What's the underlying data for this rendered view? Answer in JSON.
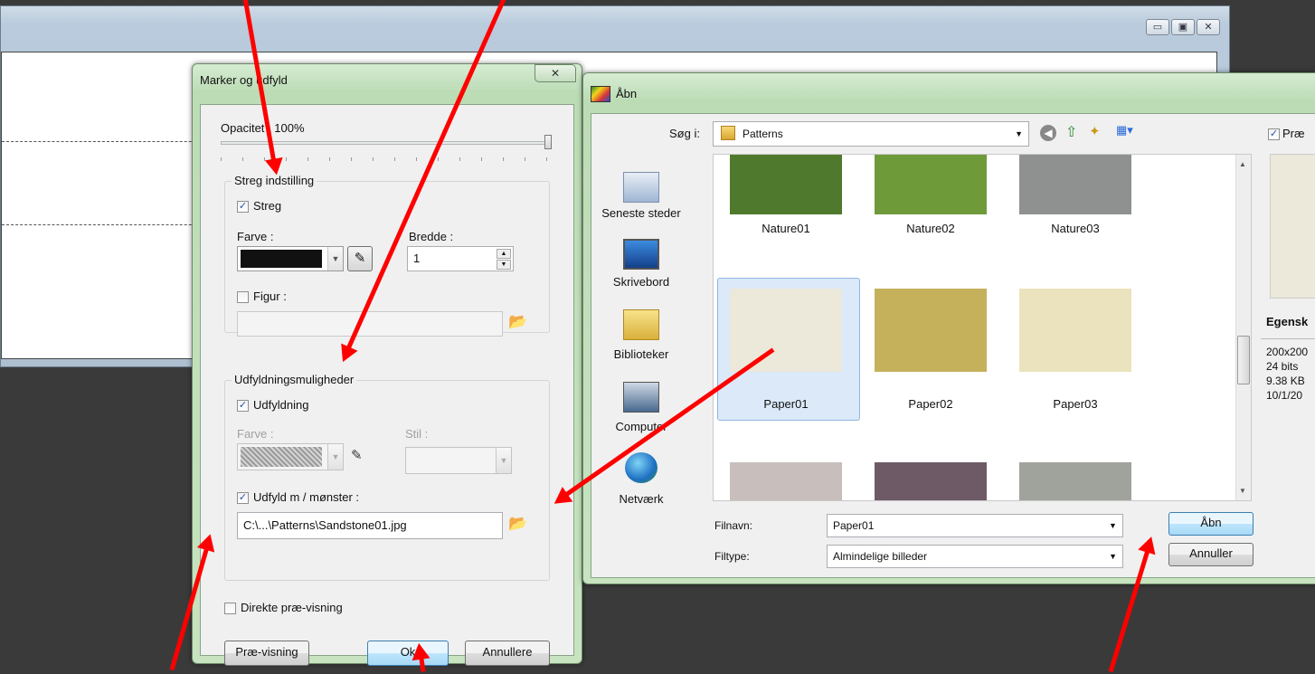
{
  "background_window": {
    "caption_buttons": [
      "▭",
      "▣",
      "✕"
    ]
  },
  "marker_dialog": {
    "title": "Marker og udfyld",
    "close_label": "✕",
    "opacity_label": "Opacitet : 100%",
    "opacity_value": 1.0,
    "stroke_group": {
      "title": "Streg indstilling",
      "stroke_checkbox": "Streg",
      "stroke_checked": true,
      "color_label": "Farve :",
      "color_value": "#111111",
      "width_label": "Bredde :",
      "width_value": "1",
      "figure_checkbox": "Figur :",
      "figure_checked": false,
      "figure_path": ""
    },
    "fill_group": {
      "title": "Udfyldningsmuligheder",
      "fill_checkbox": "Udfyldning",
      "fill_checked": true,
      "color_label": "Farve :",
      "style_label": "Stil :",
      "pattern_checkbox": "Udfyld m / mønster :",
      "pattern_checked": true,
      "pattern_path": "C:\\...\\Patterns\\Sandstone01.jpg"
    },
    "direct_preview_checkbox": "Direkte præ-visning",
    "direct_preview_checked": false,
    "preview_button": "Præ-visning",
    "ok_button": "Ok",
    "cancel_button": "Annullere"
  },
  "open_dialog": {
    "title": "Åbn",
    "look_in_label": "Søg i:",
    "look_in_value": "Patterns",
    "places": [
      {
        "label": "Seneste steder"
      },
      {
        "label": "Skrivebord"
      },
      {
        "label": "Biblioteker"
      },
      {
        "label": "Computer"
      },
      {
        "label": "Netværk"
      }
    ],
    "files": [
      {
        "name": "Nature01",
        "color": "#4f7a2e"
      },
      {
        "name": "Nature02",
        "color": "#6f9a3a"
      },
      {
        "name": "Nature03",
        "color": "#8e9190"
      },
      {
        "name": "Paper01",
        "color": "#ece8da",
        "selected": true
      },
      {
        "name": "Paper02",
        "color": "#c5b05c"
      },
      {
        "name": "Paper03",
        "color": "#ebe3bd"
      },
      {
        "name": "",
        "color": "#c8bfbc"
      },
      {
        "name": "",
        "color": "#6e5a66"
      },
      {
        "name": "",
        "color": "#9fa39c"
      }
    ],
    "filename_label": "Filnavn:",
    "filename_value": "Paper01",
    "filetype_label": "Filtype:",
    "filetype_value": "Almindelige billeder",
    "open_button": "Åbn",
    "cancel_button": "Annuller",
    "preview_checkbox": "Præ",
    "properties_label": "Egensk",
    "properties_lines": [
      "200x200",
      "24 bits",
      "9.38 KB",
      "10/1/20"
    ]
  }
}
